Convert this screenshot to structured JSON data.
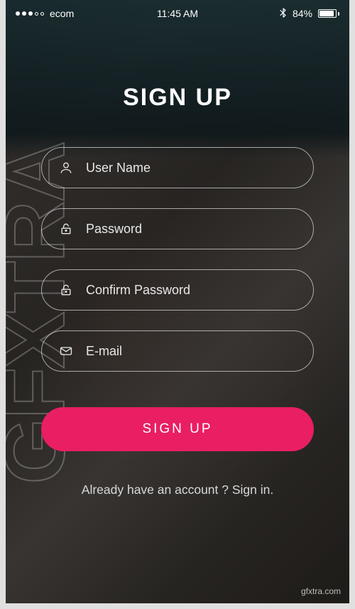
{
  "status_bar": {
    "carrier": "ecom",
    "time": "11:45 AM",
    "battery_percent": "84%"
  },
  "watermark": "GFXTRA",
  "watermark_site": "gfxtra.com",
  "title": "SIGN UP",
  "fields": {
    "username": {
      "placeholder": "User Name"
    },
    "password": {
      "placeholder": "Password"
    },
    "confirm_password": {
      "placeholder": "Confirm Password"
    },
    "email": {
      "placeholder": "E-mail"
    }
  },
  "submit_label": "SIGN UP",
  "signin_text": "Already have an account ? Sign in."
}
